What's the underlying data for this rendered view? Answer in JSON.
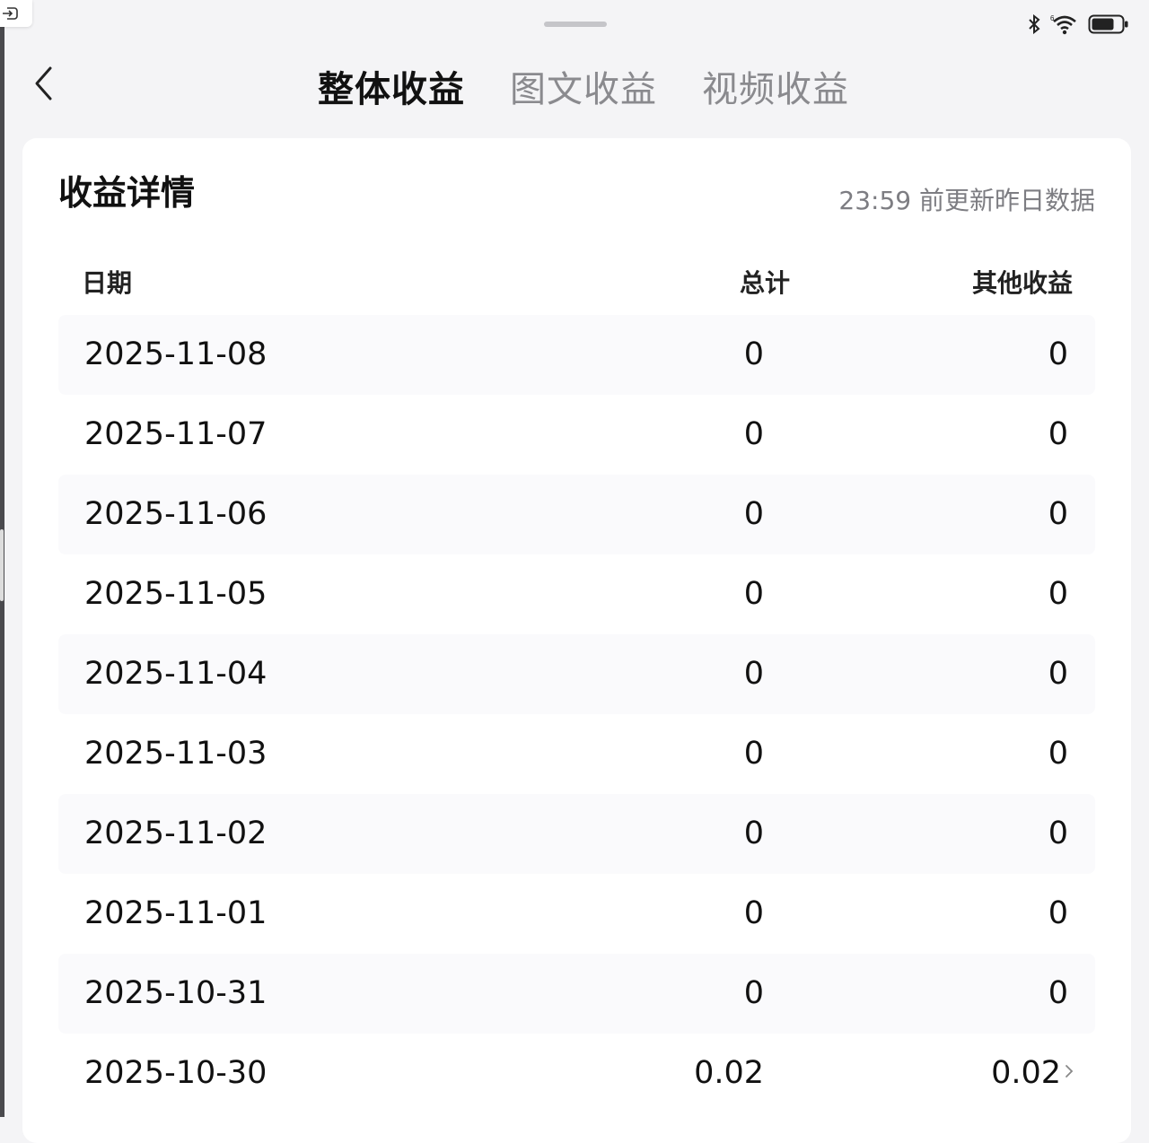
{
  "header": {
    "tabs": [
      {
        "label": "整体收益",
        "active": true
      },
      {
        "label": "图文收益",
        "active": false
      },
      {
        "label": "视频收益",
        "active": false
      }
    ]
  },
  "card": {
    "title": "收益详情",
    "update_note": "23:59 前更新昨日数据"
  },
  "table": {
    "headers": [
      "日期",
      "总计",
      "其他收益"
    ],
    "rows": [
      {
        "date": "2025-11-08",
        "total": "0",
        "other": "0"
      },
      {
        "date": "2025-11-07",
        "total": "0",
        "other": "0"
      },
      {
        "date": "2025-11-06",
        "total": "0",
        "other": "0"
      },
      {
        "date": "2025-11-05",
        "total": "0",
        "other": "0"
      },
      {
        "date": "2025-11-04",
        "total": "0",
        "other": "0"
      },
      {
        "date": "2025-11-03",
        "total": "0",
        "other": "0"
      },
      {
        "date": "2025-11-02",
        "total": "0",
        "other": "0"
      },
      {
        "date": "2025-11-01",
        "total": "0",
        "other": "0"
      },
      {
        "date": "2025-10-31",
        "total": "0",
        "other": "0"
      },
      {
        "date": "2025-10-30",
        "total": "0.02",
        "other": "0.02"
      }
    ]
  },
  "status_bar": {
    "icons": [
      "bluetooth-icon",
      "wifi-icon",
      "battery-icon"
    ],
    "battery_level": 0.75
  }
}
